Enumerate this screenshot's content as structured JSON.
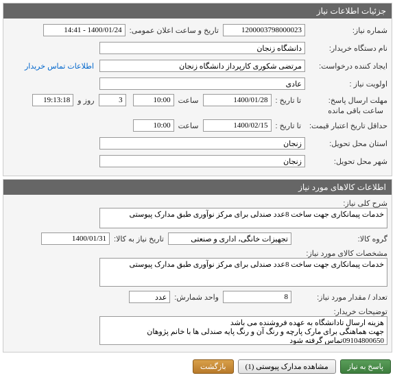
{
  "panel1": {
    "title": "جزئیات اطلاعات نیاز",
    "req_no_label": "شماره نیاز:",
    "req_no": "1200003798000023",
    "public_date_label": "تاریخ و ساعت اعلان عمومی:",
    "public_date": "1400/01/24 - 14:41",
    "buyer_label": "نام دستگاه خریدار:",
    "buyer": "دانشگاه زنجان",
    "requester_label": "ایجاد کننده درخواست:",
    "requester": "مرتضی شکوری کارپرداز دانشگاه زنجان",
    "contact_link": "اطلاعات تماس خریدار",
    "priority_label": "اولویت نیاز :",
    "priority": "عادی",
    "deadline_label": "مهلت ارسال پاسخ:",
    "until_label": "تا تاریخ :",
    "deadline_date": "1400/01/28",
    "time_label": "ساعت",
    "deadline_time": "10:00",
    "remaining_days": "3",
    "days_label": "روز و",
    "remaining_time": "19:13:18",
    "remaining_suffix": "ساعت باقی مانده",
    "min_validity_label": "حداقل تاریخ اعتبار قیمت:",
    "validity_until_label": "تا تاریخ :",
    "validity_date": "1400/02/15",
    "validity_time": "10:00",
    "province_label": "استان محل تحویل:",
    "province": "زنجان",
    "city_label": "شهر محل تحویل:",
    "city": "زنجان"
  },
  "panel2": {
    "title": "اطلاعات کالاهای مورد نیاز",
    "desc_label": "شرح کلی نیاز:",
    "desc": "خدمات پیمانکاری جهت ساخت 8عدد صندلی برای مرکز نوآوری طبق مدارک پیوستی",
    "group_label": "گروه کالا:",
    "group": "تجهیزات خانگی، اداری و صنعتی",
    "goods_date_label": "تاریخ نیاز به کالا:",
    "goods_date": "1400/01/31",
    "spec_label": "مشخصات کالای مورد نیاز:",
    "spec": "خدمات پیمانکاری جهت ساخت 8عدد صندلی برای مرکز نوآوری طبق مدارک پیوستی",
    "qty_label": "تعداد / مقدار مورد نیاز:",
    "qty": "8",
    "unit_label": "واحد شمارش:",
    "unit": "عدد",
    "notes_label": "توضیحات خریدار:",
    "notes": "هزینه ارسال تادانشگاه به عهده فروشنده می باشد\nجهت هماهنگی برای مارک پارچه و رنگ آن و رنگ پایه صندلی ها با خانم پژوهان 09104800650تماس گرفته شود\nخدمت فوق به صورت قرارداد با امور حقوقی انجام میگیرد."
  },
  "buttons": {
    "respond": "پاسخ به نیاز",
    "view_attach": "مشاهده مدارک پیوستی (1)",
    "back": "بازگشت"
  }
}
